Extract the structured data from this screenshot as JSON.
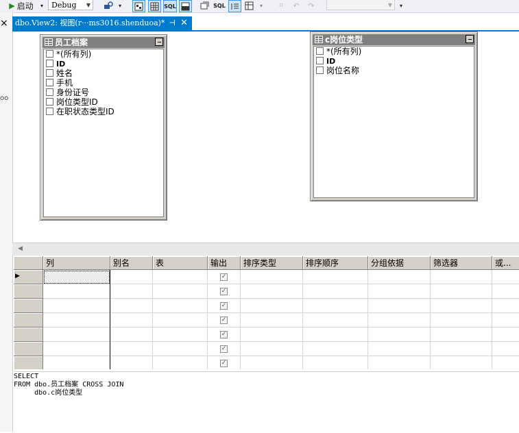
{
  "toolbar": {
    "start_label": "启动",
    "config_value": "Debug",
    "sql_label": "SQL"
  },
  "left_strip": {
    "close_glyph": "×",
    "fragment": "oo"
  },
  "tab": {
    "title": "dbo.View2: 视图(r···ms3016.shenduoa)*"
  },
  "tables": [
    {
      "title": "员工档案",
      "columns": [
        "*(所有列)",
        "ID",
        "姓名",
        "手机",
        "身份证号",
        "岗位类型ID",
        "在职状态类型ID"
      ]
    },
    {
      "title": "c岗位类型",
      "columns": [
        "*(所有列)",
        "ID",
        "岗位名称"
      ]
    }
  ],
  "grid": {
    "headers": [
      "列",
      "别名",
      "表",
      "输出",
      "排序类型",
      "排序顺序",
      "分组依据",
      "筛选器",
      "或..."
    ],
    "row_count": 7,
    "output_checked": [
      true,
      true,
      true,
      true,
      true,
      true,
      true
    ]
  },
  "sql_text": "SELECT\nFROM dbo.员工档案 CROSS JOIN\n     dbo.c岗位类型",
  "colors": {
    "accent": "#007acc",
    "chrome": "#d4d0c8"
  }
}
